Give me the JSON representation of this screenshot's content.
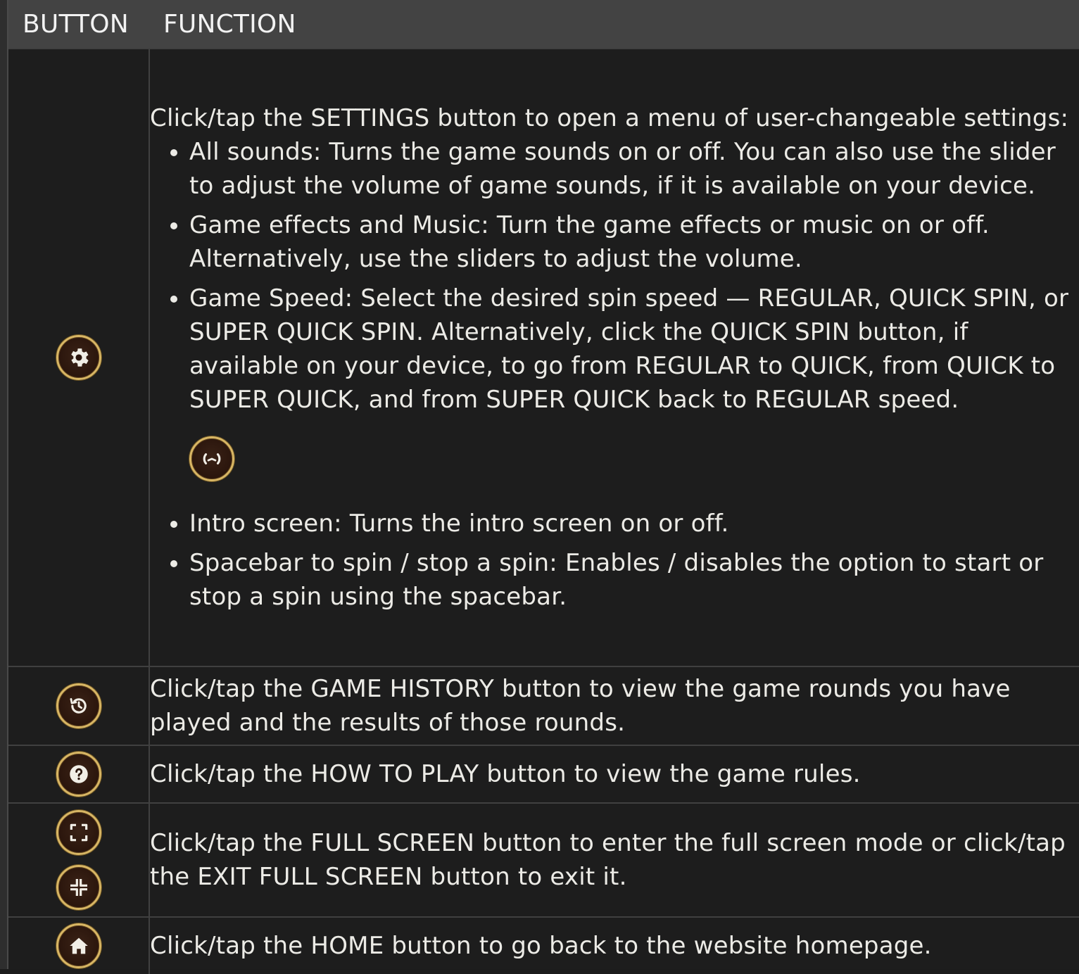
{
  "header": {
    "col_button": "BUTTON",
    "col_function": "FUNCTION"
  },
  "rows": {
    "settings": {
      "icon": "gear-icon",
      "intro": "Click/tap the SETTINGS button to open a menu of user-changeable settings:",
      "items": [
        "All sounds: Turns the game sounds on or off. You can also use the slider to adjust the volume of game sounds, if it is available on your device.",
        "Game effects and Music: Turn the game effects or music on or off. Alternatively, use the sliders to adjust the volume.",
        "Game Speed: Select the desired spin speed — REGULAR, QUICK SPIN, or SUPER QUICK SPIN. Alternatively, click the QUICK SPIN button, if available on your device, to go from REGULAR to QUICK, from QUICK to SUPER QUICK, and from SUPER QUICK back to REGULAR speed.",
        "Intro screen: Turns the intro screen on or off.",
        "Spacebar to spin / stop a spin: Enables / disables the option to start or stop a spin using the spacebar."
      ],
      "inline_icon": "quick-spin-icon"
    },
    "history": {
      "icon": "history-icon",
      "text": "Click/tap the GAME HISTORY button to view the game rounds you have played and the results of those rounds."
    },
    "howto": {
      "icon": "question-icon",
      "text": "Click/tap the HOW TO PLAY button to view the game rules."
    },
    "fullscreen": {
      "icons": [
        "fullscreen-icon",
        "exit-fullscreen-icon"
      ],
      "text": "Click/tap the FULL SCREEN button to enter the full screen mode or click/tap the EXIT FULL SCREEN button to exit it."
    },
    "home": {
      "icon": "home-icon",
      "text": "Click/tap the HOME button to go back to the website homepage."
    }
  },
  "colors": {
    "background": "#1d1d1d",
    "header": "#434343",
    "divider": "#404040",
    "icon_ring": "#d8b664",
    "icon_fill": "#2a150c",
    "text": "#ecebe6"
  }
}
